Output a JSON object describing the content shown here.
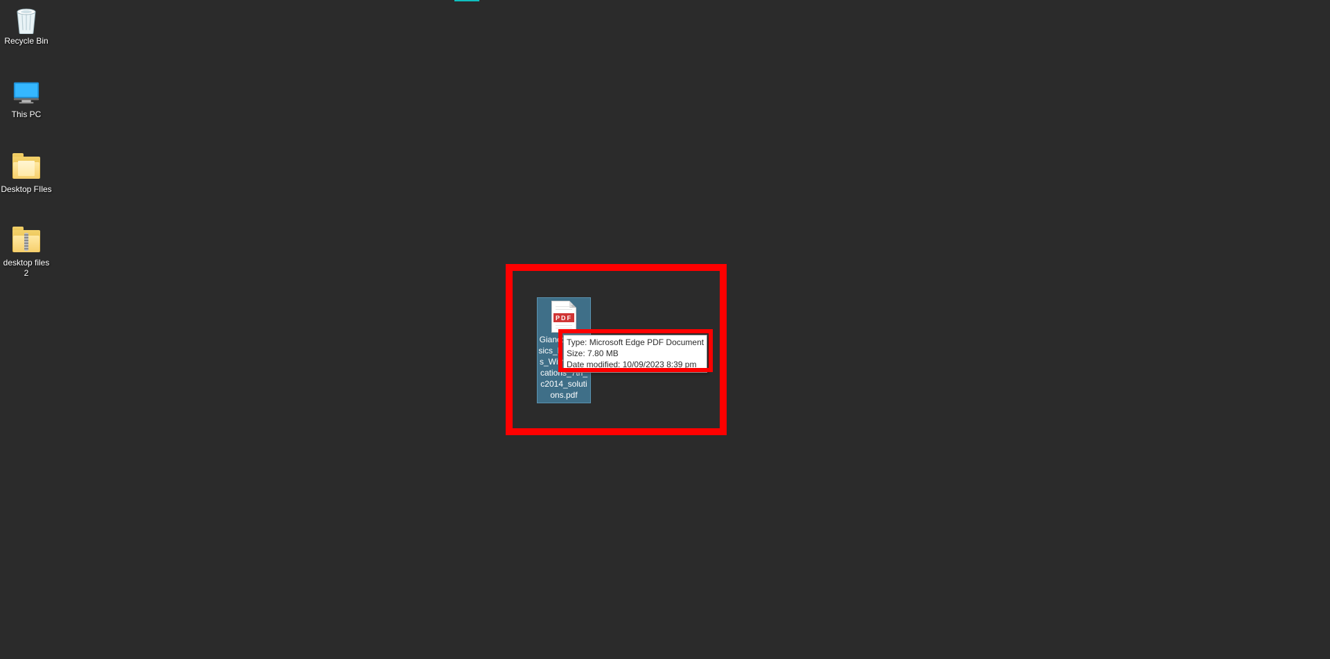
{
  "desktop": {
    "icons": [
      {
        "key": "recycle-bin",
        "label": "Recycle Bin"
      },
      {
        "key": "this-pc",
        "label": "This PC"
      },
      {
        "key": "desktop-files",
        "label": "Desktop FIles"
      },
      {
        "key": "desktop-files-2",
        "label": "desktop files 2"
      }
    ],
    "selected_file": {
      "filename": "Giancoli_Physics_Principles_With_Applications_7th_c2014_solutions.pdf",
      "pdf_badge": "PDF"
    }
  },
  "tooltip": {
    "type_label": "Type:",
    "type_value": "Microsoft Edge PDF Document",
    "size_label": "Size:",
    "size_value": "7.80 MB",
    "modified_label": "Date modified:",
    "modified_value": "10/09/2023 8:39 pm"
  }
}
